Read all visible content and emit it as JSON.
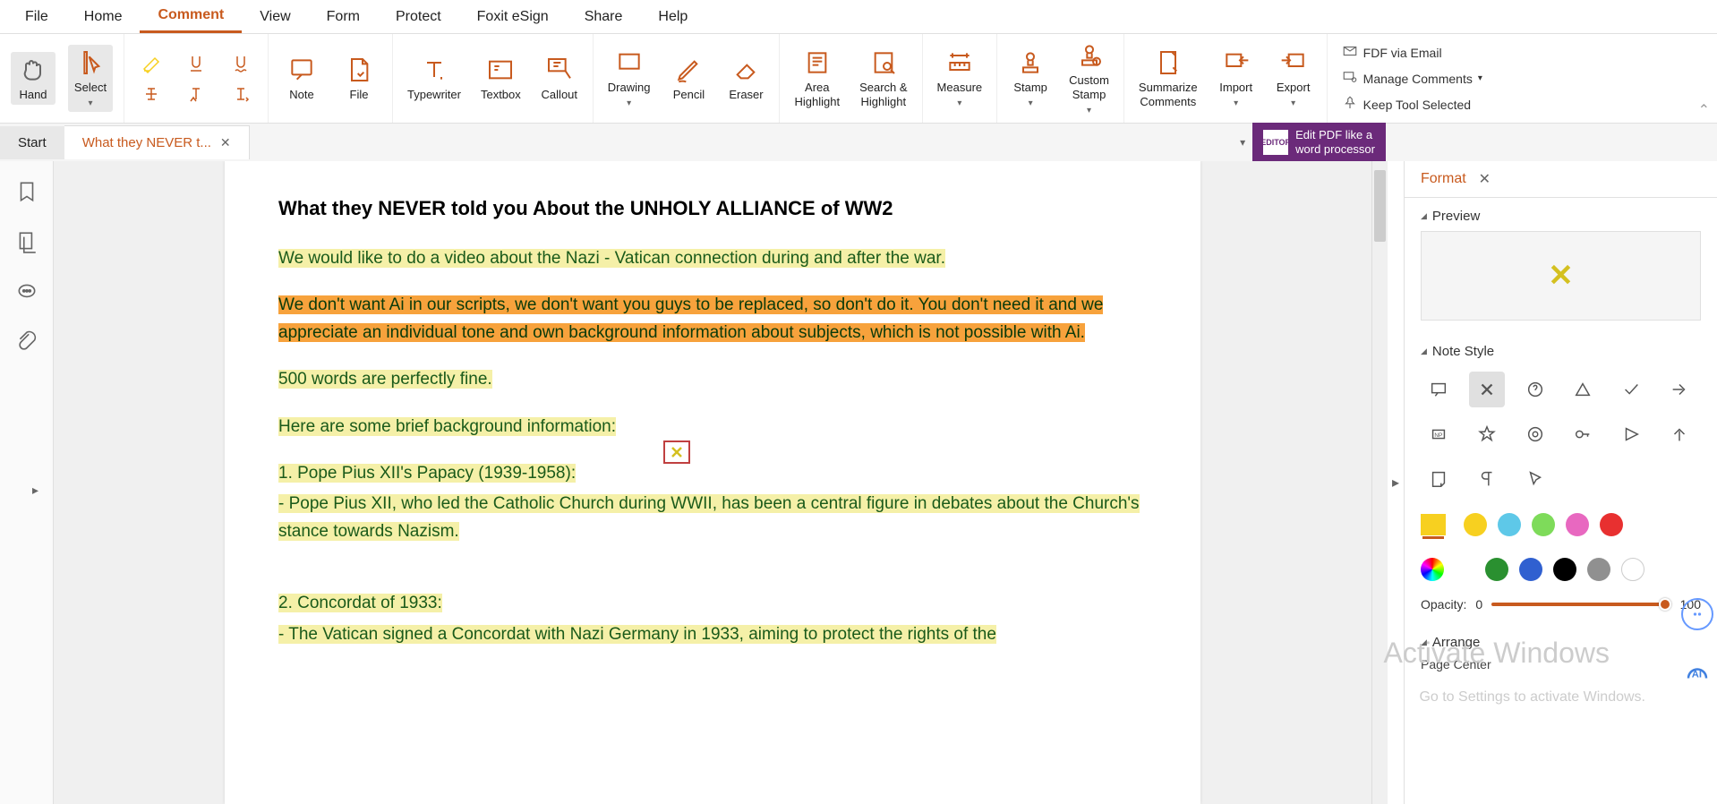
{
  "menubar": [
    "File",
    "Home",
    "Comment",
    "View",
    "Form",
    "Protect",
    "Foxit eSign",
    "Share",
    "Help"
  ],
  "menubar_active": 2,
  "ribbon": {
    "hand": "Hand",
    "select": "Select",
    "note": "Note",
    "file": "File",
    "typewriter": "Typewriter",
    "textbox": "Textbox",
    "callout": "Callout",
    "drawing": "Drawing",
    "pencil": "Pencil",
    "eraser": "Eraser",
    "area_highlight": "Area\nHighlight",
    "search_highlight": "Search &\nHighlight",
    "measure": "Measure",
    "stamp": "Stamp",
    "custom_stamp": "Custom\nStamp",
    "summarize": "Summarize\nComments",
    "import": "Import",
    "export": "Export"
  },
  "ribbon_right": {
    "fdf": "FDF via Email",
    "manage": "Manage Comments",
    "keep_tool": "Keep Tool Selected"
  },
  "tabs": {
    "start": "Start",
    "doc": "What they NEVER t..."
  },
  "promo": {
    "editor": "EDITOR",
    "line1": "Edit PDF like a",
    "line2": "word processor"
  },
  "document": {
    "title": "What they NEVER told you About the UNHOLY ALLIANCE of WW2",
    "p1": "We would like to do a video about the Nazi - Vatican connection during and after the war.",
    "p2": "We don't want Ai in our scripts, we don't want you guys to be replaced, so don't do it. You don't need it and we appreciate an individual tone and own background information about subjects, which is not possible with Ai.",
    "p3": "500 words are perfectly fine.",
    "p4": "Here are some brief background information:",
    "p5": "1. Pope Pius XII's Papacy (1939-1958):",
    "p6": "- Pope Pius XII, who led the Catholic Church during WWII, has been a central figure in debates about the Church's stance towards Nazism.",
    "p7": "2. Concordat of 1933:",
    "p8": "- The Vatican signed a Concordat with Nazi Germany in 1933, aiming to protect the rights of the"
  },
  "right_panel": {
    "tab": "Format",
    "preview": "Preview",
    "note_style": "Note Style",
    "opacity_label": "Opacity:",
    "opacity_min": "0",
    "opacity_max": "100",
    "arrange": "Arrange",
    "page_center": "Page Center"
  },
  "colors": {
    "row1": [
      "#f7d020",
      "#5ec8e8",
      "#7edb5a",
      "#e868c0",
      "#e83030"
    ],
    "row2": [
      "#2a9030",
      "#3060d0",
      "#000000",
      "#909090",
      "#ffffff"
    ]
  },
  "watermark": {
    "title": "Activate Windows",
    "sub": "Go to Settings to activate Windows."
  }
}
